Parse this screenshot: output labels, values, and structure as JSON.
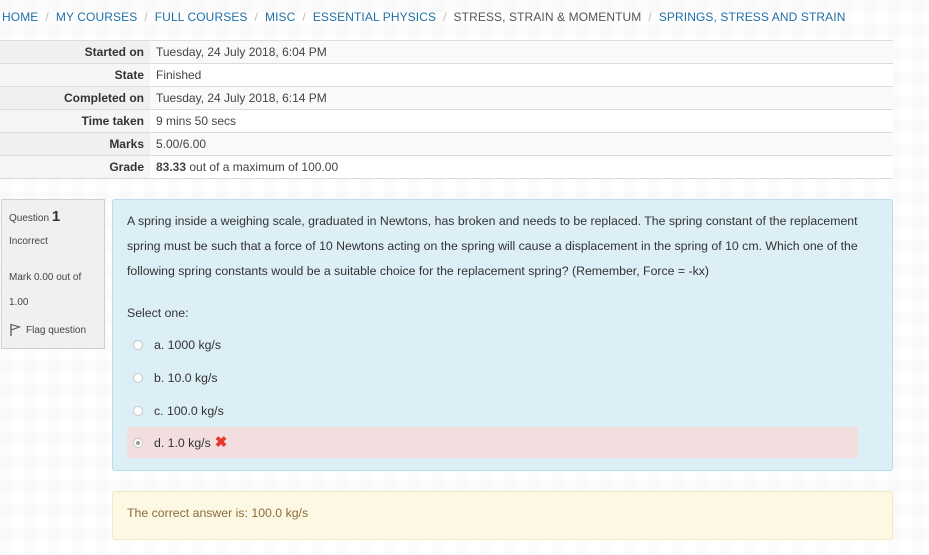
{
  "breadcrumb": {
    "items": [
      {
        "label": "HOME",
        "link": true
      },
      {
        "label": "MY COURSES",
        "link": true
      },
      {
        "label": "FULL COURSES",
        "link": true
      },
      {
        "label": "MISC",
        "link": true
      },
      {
        "label": "ESSENTIAL PHYSICS",
        "link": true
      },
      {
        "label": "STRESS, STRAIN & MOMENTUM",
        "link": false
      },
      {
        "label": "SPRINGS, STRESS AND STRAIN",
        "link": true
      }
    ],
    "separator": "/"
  },
  "summary": {
    "started_on": {
      "label": "Started on",
      "value": "Tuesday, 24 July 2018, 6:04 PM"
    },
    "state": {
      "label": "State",
      "value": "Finished"
    },
    "completed_on": {
      "label": "Completed on",
      "value": "Tuesday, 24 July 2018, 6:14 PM"
    },
    "time_taken": {
      "label": "Time taken",
      "value": "9 mins 50 secs"
    },
    "marks": {
      "label": "Marks",
      "value": "5.00/6.00"
    },
    "grade": {
      "label": "Grade",
      "value_bold": "83.33",
      "value_rest": "out of a maximum of 100.00"
    }
  },
  "question_info": {
    "question_label": "Question",
    "question_number": "1",
    "state": "Incorrect",
    "mark_line1": "Mark 0.00 out of",
    "mark_line2": "1.00",
    "flag_label": "Flag question"
  },
  "question": {
    "text": "A spring inside a weighing scale, graduated in Newtons, has broken and needs to be replaced. The spring constant of the replacement spring must be such that a force of 10 Newtons acting on the spring will cause a displacement in the spring of 10 cm. Which one of the following spring constants would be a suitable choice for the replacement spring? (Remember, Force = -kx)",
    "prompt": "Select one:",
    "options": [
      {
        "label": "a. 1000 kg/s",
        "selected": false
      },
      {
        "label": "b. 10.0 kg/s",
        "selected": false
      },
      {
        "label": "c. 100.0 kg/s",
        "selected": false
      },
      {
        "label": "d. 1.0 kg/s",
        "selected": true
      }
    ],
    "incorrect_icon": "cross-mark-icon",
    "incorrect_icon_glyph": "✖"
  },
  "feedback": {
    "text": "The correct answer is: 100.0 kg/s"
  },
  "colors": {
    "link": "#1f6fa8",
    "question_bg": "#dceef6",
    "incorrect_bg": "#f2dede",
    "feedback_bg": "#fcf8e3",
    "feedback_text": "#8a6d3b",
    "cross": "#e53a2e"
  }
}
